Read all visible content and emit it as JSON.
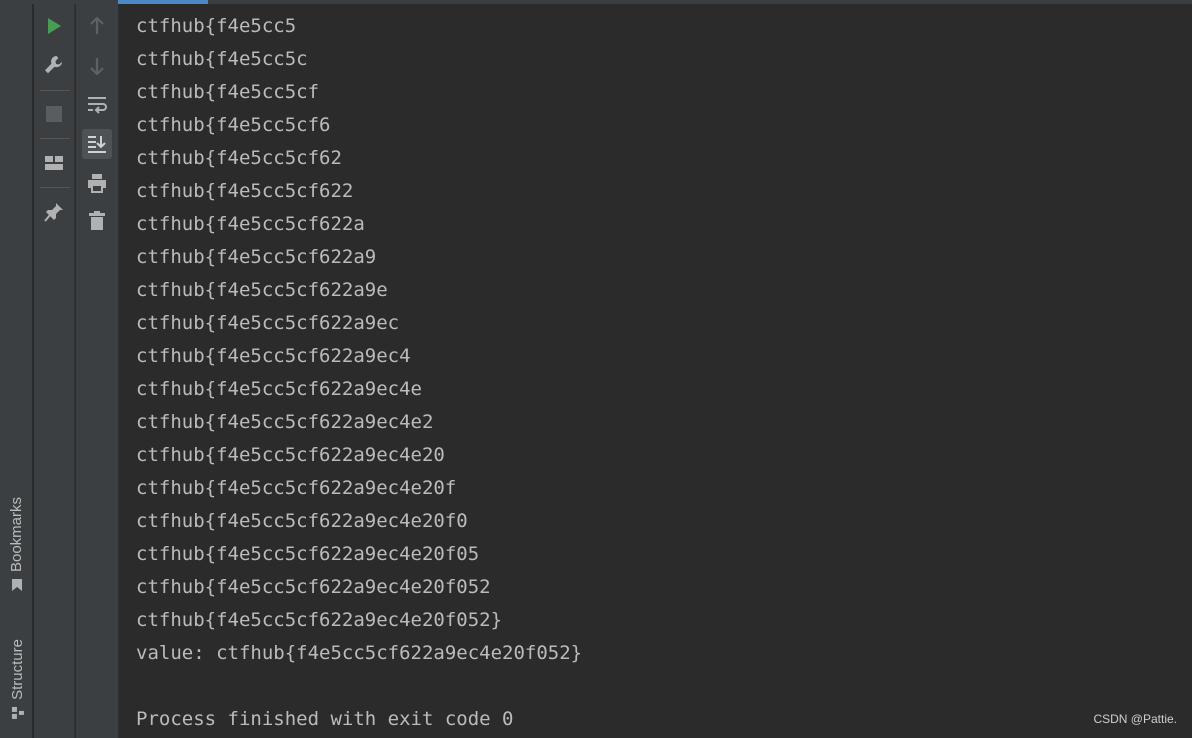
{
  "sidebar": {
    "bookmarks_label": "Bookmarks",
    "structure_label": "Structure"
  },
  "toolbar": {
    "run": "run-icon",
    "settings": "wrench-icon",
    "stop": "stop-icon",
    "layout": "layout-icon",
    "pin": "pin-icon",
    "up": "arrow-up-icon",
    "down": "arrow-down-icon",
    "soft_wrap": "soft-wrap-icon",
    "scroll_to_end": "scroll-to-end-icon",
    "print": "print-icon",
    "clear": "trash-icon"
  },
  "console": {
    "lines": [
      "ctfhub{f4e5cc5",
      "ctfhub{f4e5cc5c",
      "ctfhub{f4e5cc5cf",
      "ctfhub{f4e5cc5cf6",
      "ctfhub{f4e5cc5cf62",
      "ctfhub{f4e5cc5cf622",
      "ctfhub{f4e5cc5cf622a",
      "ctfhub{f4e5cc5cf622a9",
      "ctfhub{f4e5cc5cf622a9e",
      "ctfhub{f4e5cc5cf622a9ec",
      "ctfhub{f4e5cc5cf622a9ec4",
      "ctfhub{f4e5cc5cf622a9ec4e",
      "ctfhub{f4e5cc5cf622a9ec4e2",
      "ctfhub{f4e5cc5cf622a9ec4e20",
      "ctfhub{f4e5cc5cf622a9ec4e20f",
      "ctfhub{f4e5cc5cf622a9ec4e20f0",
      "ctfhub{f4e5cc5cf622a9ec4e20f05",
      "ctfhub{f4e5cc5cf622a9ec4e20f052",
      "ctfhub{f4e5cc5cf622a9ec4e20f052}",
      "value: ctfhub{f4e5cc5cf622a9ec4e20f052}",
      "",
      "Process finished with exit code 0"
    ],
    "watermark": "CSDN @Pattie."
  },
  "colors": {
    "background": "#2b2b2b",
    "panel": "#3c3f41",
    "text": "#bbbbbb",
    "run_green": "#499c54",
    "accent": "#4a88c7"
  }
}
